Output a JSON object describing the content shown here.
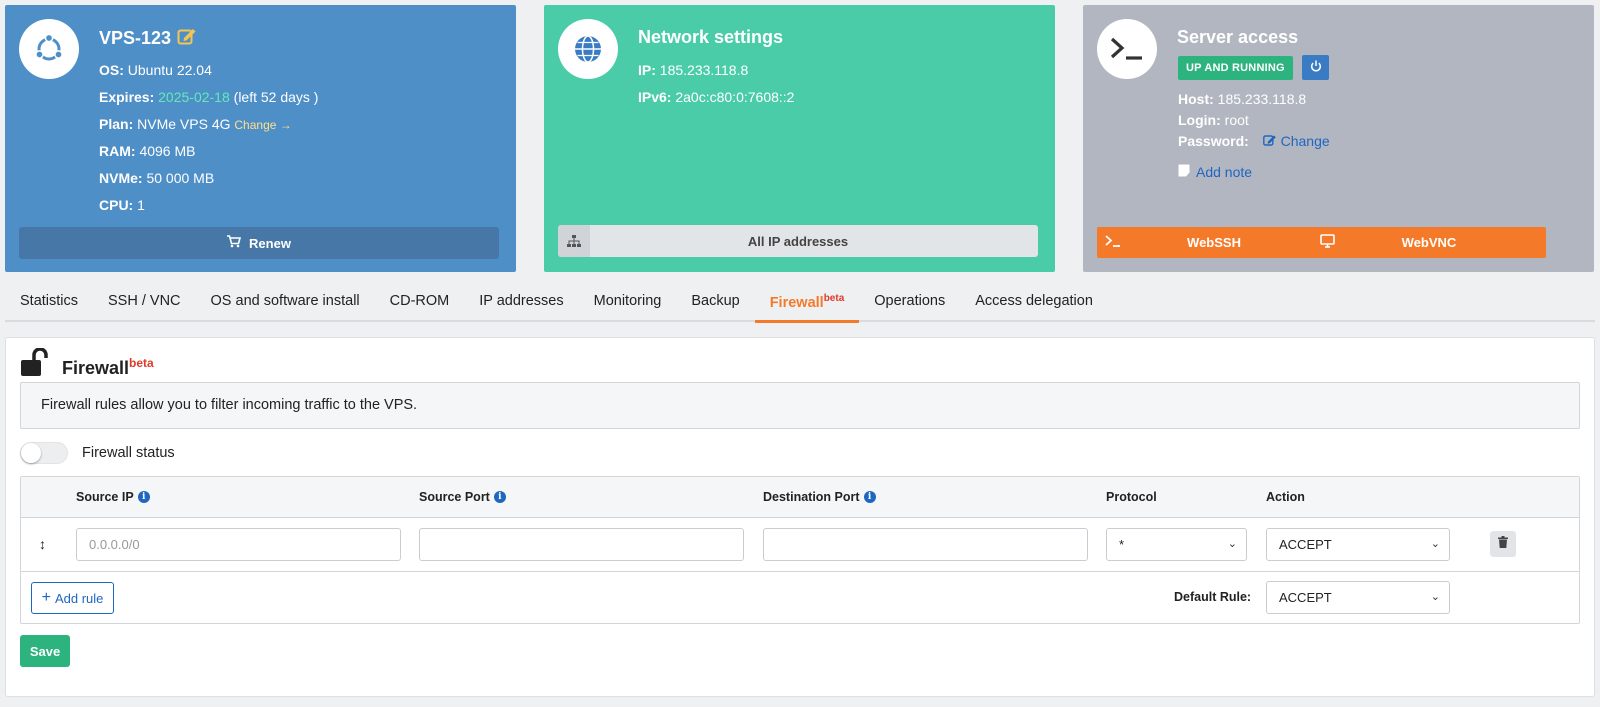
{
  "vps": {
    "title": "VPS-123",
    "os_label": "OS:",
    "os_value": "Ubuntu 22.04",
    "expires_label": "Expires:",
    "expires_date": "2025-02-18",
    "expires_left": "(left 52 days )",
    "plan_label": "Plan:",
    "plan_value": "NVMe VPS 4G",
    "plan_change": "Change",
    "ram_label": "RAM:",
    "ram_value": "4096 MB",
    "nvme_label": "NVMe:",
    "nvme_value": "50 000 MB",
    "cpu_label": "CPU:",
    "cpu_value": "1",
    "renew_label": "Renew"
  },
  "network": {
    "title": "Network settings",
    "ip_label": "IP:",
    "ip_value": "185.233.118.8",
    "ipv6_label": "IPv6:",
    "ipv6_value": "2a0c:c80:0:7608::2",
    "all_ip_label": "All IP addresses"
  },
  "server": {
    "title": "Server access",
    "status": "UP AND RUNNING",
    "host_label": "Host:",
    "host_value": "185.233.118.8",
    "login_label": "Login:",
    "login_value": "root",
    "password_label": "Password:",
    "password_change": "Change",
    "add_note": "Add note",
    "webssh": "WebSSH",
    "webvnc": "WebVNC"
  },
  "tabs": [
    {
      "label": "Statistics"
    },
    {
      "label": "SSH / VNC"
    },
    {
      "label": "OS and software install"
    },
    {
      "label": "CD-ROM"
    },
    {
      "label": "IP addresses"
    },
    {
      "label": "Monitoring"
    },
    {
      "label": "Backup"
    },
    {
      "label": "Firewall",
      "sup": "beta"
    },
    {
      "label": "Operations"
    },
    {
      "label": "Access delegation"
    }
  ],
  "firewall": {
    "title": "Firewall",
    "title_sup": "beta",
    "notice": "Firewall rules allow you to filter incoming traffic to the VPS.",
    "status_label": "Firewall status",
    "columns": {
      "source_ip": "Source IP",
      "source_port": "Source Port",
      "destination_port": "Destination Port",
      "protocol": "Protocol",
      "action": "Action"
    },
    "row": {
      "source_ip_placeholder": "0.0.0.0/0",
      "source_port": "",
      "destination_port": "",
      "protocol": "*",
      "action": "ACCEPT"
    },
    "add_rule": "Add rule",
    "default_rule_label": "Default Rule:",
    "default_rule_value": "ACCEPT",
    "save": "Save"
  },
  "colors": {
    "vps_card": "#4f8fc7",
    "network_card": "#4acca9",
    "server_card": "#b2b6c0",
    "accent": "#f47a2a",
    "success": "#2db37e"
  }
}
